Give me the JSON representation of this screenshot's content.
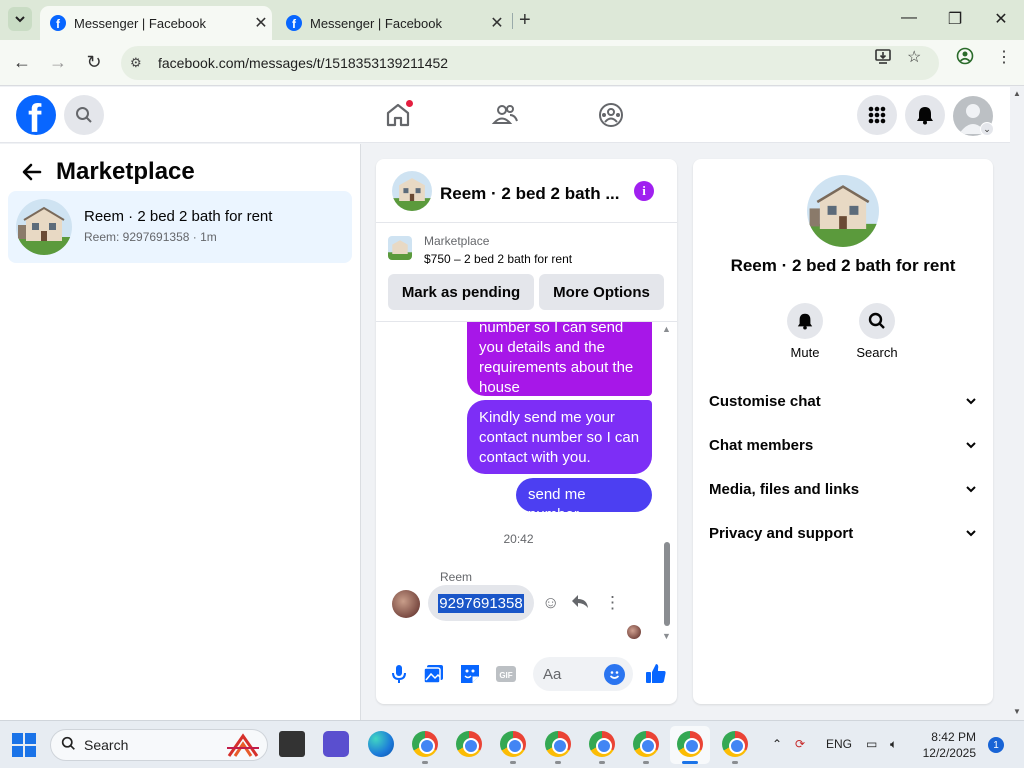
{
  "browser": {
    "tabs": [
      {
        "title": "Messenger | Facebook",
        "active": true
      },
      {
        "title": "Messenger | Facebook",
        "active": false
      }
    ],
    "url": "facebook.com/messages/t/1518353139211452",
    "window_controls": {
      "minimize": "—",
      "restore": "❐",
      "close": "✕"
    }
  },
  "left_panel": {
    "title": "Marketplace",
    "conversations": [
      {
        "name": "Reem · 2 bed 2 bath for rent",
        "preview": "Reem: 9297691358 · 1m"
      }
    ]
  },
  "chat": {
    "title": "Reem · 2 bed 2 bath ...",
    "marketplace": {
      "label": "Marketplace",
      "listing": "$750 – 2 bed 2 bath for rent",
      "mark_pending": "Mark as pending",
      "more_options": "More Options"
    },
    "messages": [
      {
        "from": "me",
        "text": "number so I can send you details and the requirements about the house"
      },
      {
        "from": "me",
        "text": "Kindly send me your contact number so I can contact with you."
      },
      {
        "from": "me",
        "text": "send me number"
      }
    ],
    "timestamp": "20:42",
    "received": {
      "sender": "Reem",
      "text": "9297691358"
    },
    "composer_placeholder": "Aa"
  },
  "info_panel": {
    "name": "Reem · 2 bed 2 bath for rent",
    "actions": [
      {
        "label": "Mute",
        "icon": "bell-icon"
      },
      {
        "label": "Search",
        "icon": "search-icon"
      }
    ],
    "sections": [
      "Customise chat",
      "Chat members",
      "Media, files and links",
      "Privacy and support"
    ]
  },
  "taskbar": {
    "search_label": "Search",
    "language": "ENG",
    "time": "8:42 PM",
    "date": "12/2/2025",
    "notification_count": "1"
  },
  "colors": {
    "facebook_blue": "#0866ff",
    "bubble_purple": "#a717e8",
    "bubble_violet": "#7d2ef6",
    "bubble_indigo": "#4c3ff2",
    "selected_conversation": "#ebf5ff"
  }
}
